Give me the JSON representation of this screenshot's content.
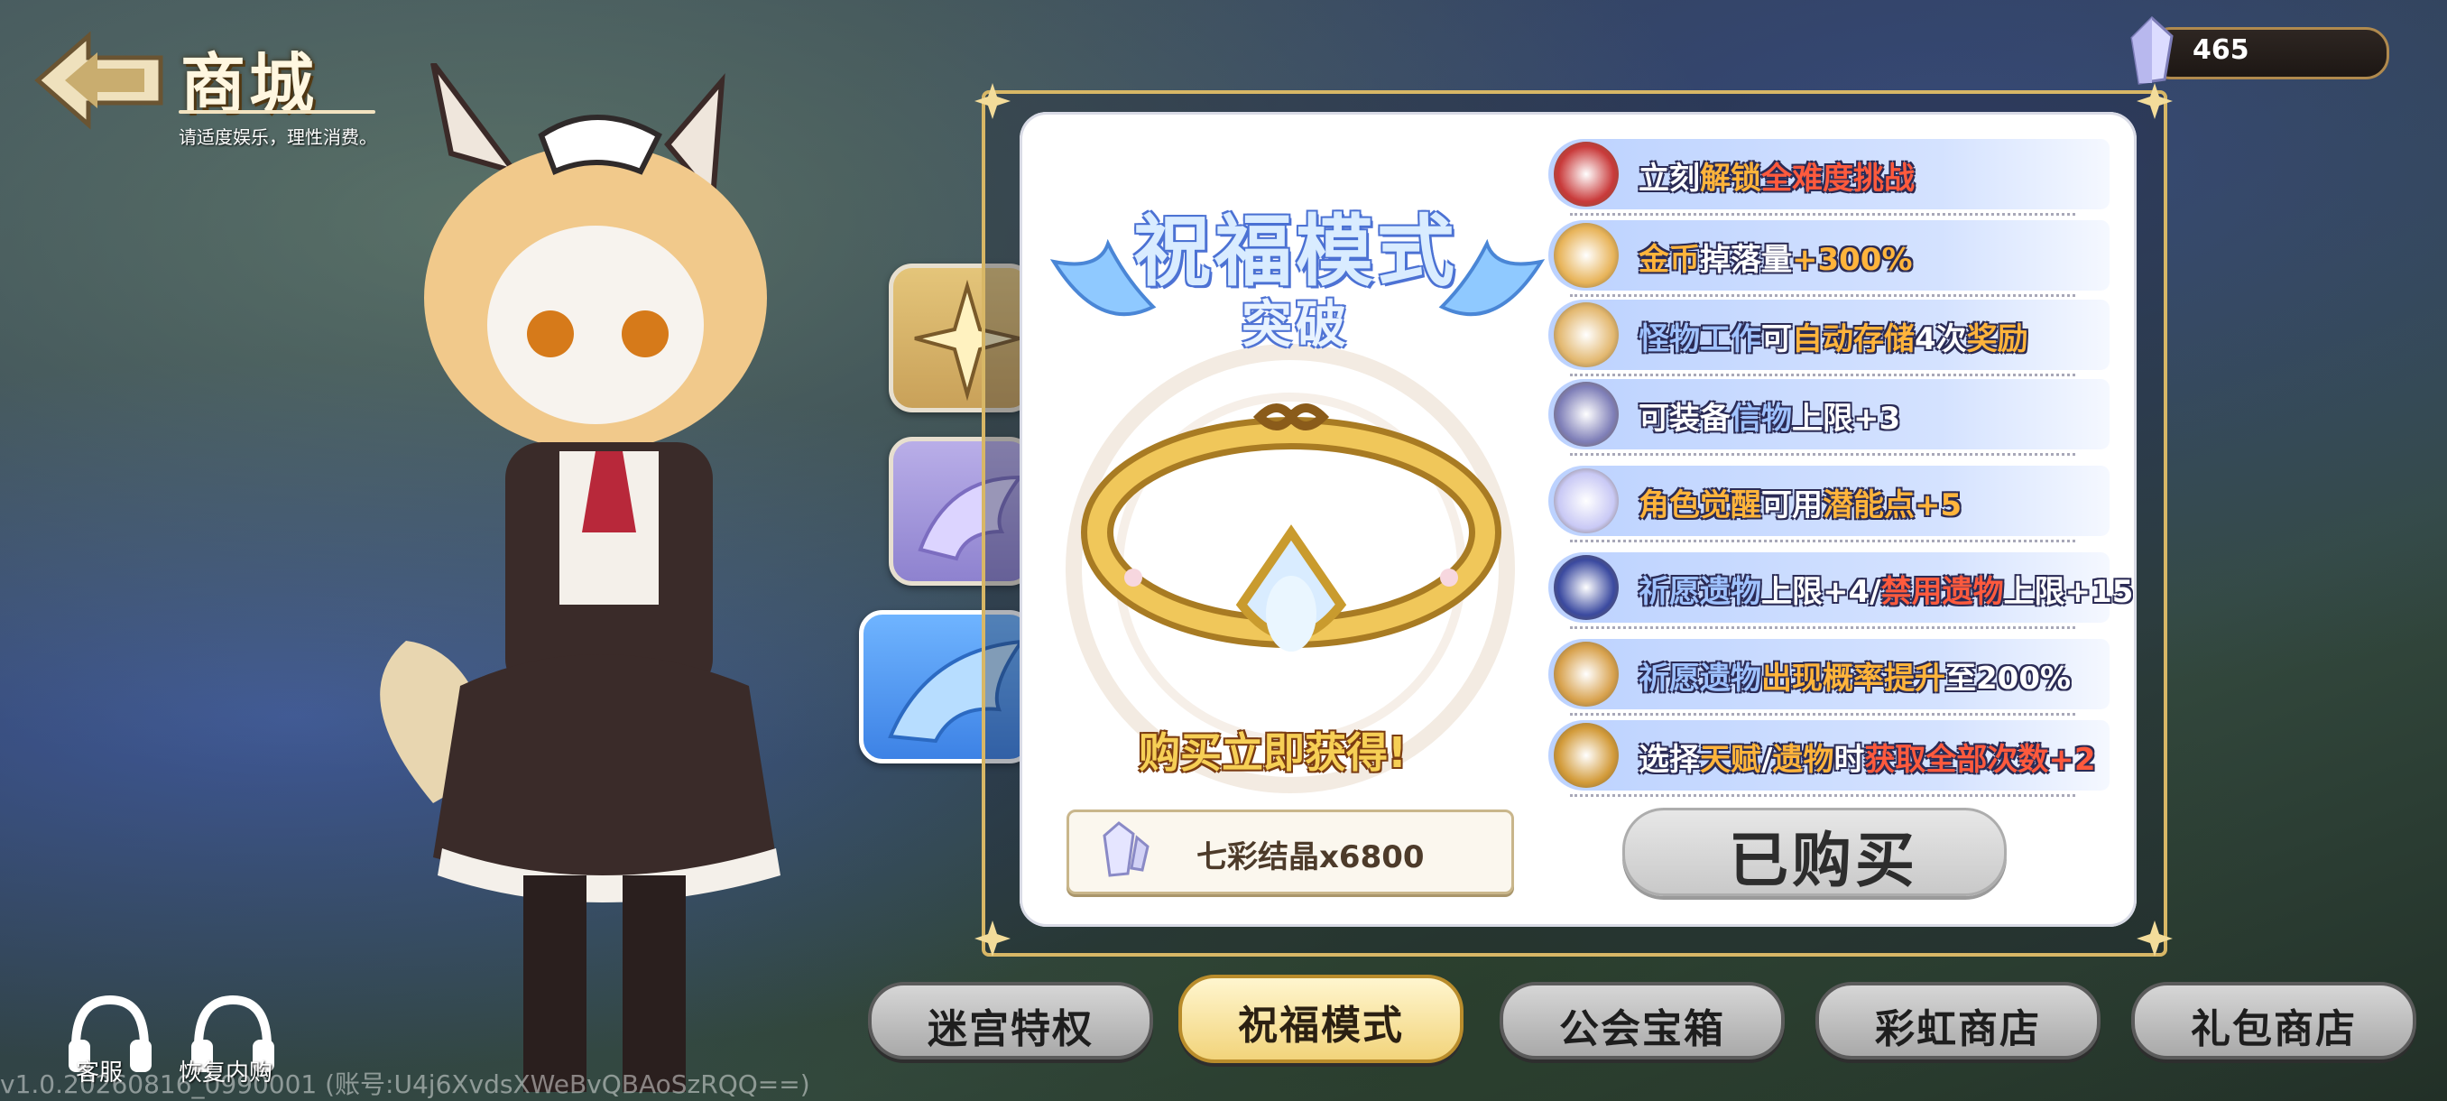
{
  "header": {
    "title": "商城",
    "subtitle": "请适度娱乐，理性消费。"
  },
  "currency": {
    "icon": "crystal-icon",
    "value": "465"
  },
  "panel": {
    "mode_title": "祝福模式",
    "mode_subtitle": "突破",
    "buy_now": "购买立即获得!",
    "price": "七彩结晶x6800",
    "purchased_label": "已购买",
    "benefits": [
      {
        "icon": "target-icon",
        "parts": [
          {
            "t": "立刻",
            "c": "white"
          },
          {
            "t": "解锁",
            "c": "orange"
          },
          {
            "t": "全难度挑战",
            "c": "red"
          }
        ]
      },
      {
        "icon": "gold-coins-icon",
        "parts": [
          {
            "t": "金币",
            "c": "orange"
          },
          {
            "t": "掉落量",
            "c": "white"
          },
          {
            "t": "+300%",
            "c": "orange"
          }
        ]
      },
      {
        "icon": "crates-icon",
        "parts": [
          {
            "t": "怪物工作",
            "c": "blue"
          },
          {
            "t": "可",
            "c": "white"
          },
          {
            "t": "自动存储",
            "c": "orange"
          },
          {
            "t": "4次",
            "c": "white"
          },
          {
            "t": "奖励",
            "c": "orange"
          }
        ]
      },
      {
        "icon": "badge-icon",
        "parts": [
          {
            "t": "可装备",
            "c": "white"
          },
          {
            "t": "信物",
            "c": "blue"
          },
          {
            "t": "上限+3",
            "c": "white"
          }
        ]
      },
      {
        "icon": "crystal-shard-icon",
        "parts": [
          {
            "t": "角色觉醒",
            "c": "orange"
          },
          {
            "t": "可用",
            "c": "white"
          },
          {
            "t": "潜能点",
            "c": "orange"
          },
          {
            "t": "+5",
            "c": "orange"
          }
        ]
      },
      {
        "icon": "relic-card-icon",
        "parts": [
          {
            "t": "祈愿遗物",
            "c": "blue"
          },
          {
            "t": "上限+4/",
            "c": "white"
          },
          {
            "t": "禁用遗物",
            "c": "red"
          },
          {
            "t": "上限+15",
            "c": "white"
          }
        ]
      },
      {
        "icon": "money-bag-icon",
        "parts": [
          {
            "t": "祈愿遗物",
            "c": "blue"
          },
          {
            "t": "出现概率提升",
            "c": "orange"
          },
          {
            "t": "至200%",
            "c": "white"
          }
        ]
      },
      {
        "icon": "coin-bag-icon",
        "parts": [
          {
            "t": "选择",
            "c": "white"
          },
          {
            "t": "天赋",
            "c": "orange"
          },
          {
            "t": "/",
            "c": "white"
          },
          {
            "t": "遗物",
            "c": "orange"
          },
          {
            "t": "时",
            "c": "white"
          },
          {
            "t": "获取全部次数",
            "c": "red"
          },
          {
            "t": "+2",
            "c": "red"
          }
        ]
      }
    ]
  },
  "bottom_tabs": [
    {
      "label": "迷宫特权",
      "active": false
    },
    {
      "label": "祝福模式",
      "active": true
    },
    {
      "label": "公会宝箱",
      "active": false
    },
    {
      "label": "彩虹商店",
      "active": false
    },
    {
      "label": "礼包商店",
      "active": false
    }
  ],
  "corner_buttons": {
    "support": "客服",
    "restore": "恢复内购"
  },
  "version": "v1.0.20260816_0990001 (账号:U4j6XvdsXWeBvQBAoSzRQQ==)"
}
